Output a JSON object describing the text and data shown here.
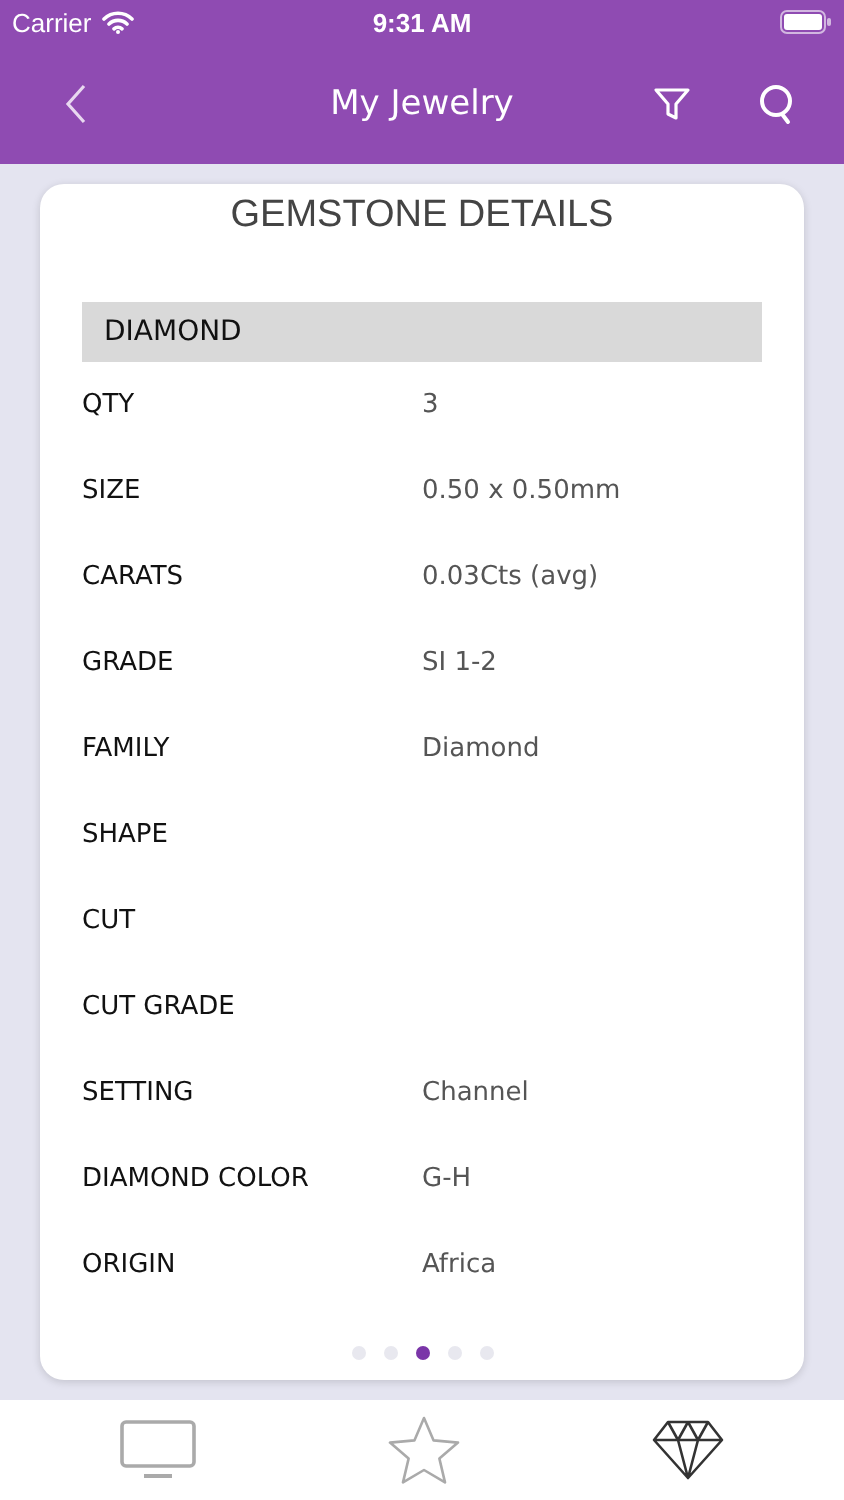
{
  "status_bar": {
    "carrier": "Carrier",
    "time": "9:31 AM"
  },
  "nav": {
    "title": "My Jewelry"
  },
  "card": {
    "title": "GEMSTONE DETAILS",
    "section": "DIAMOND",
    "rows": [
      {
        "label": "QTY",
        "value": "3"
      },
      {
        "label": "SIZE",
        "value": "0.50 x 0.50mm"
      },
      {
        "label": "CARATS",
        "value": "0.03Cts (avg)"
      },
      {
        "label": "GRADE",
        "value": "SI 1-2"
      },
      {
        "label": "FAMILY",
        "value": "Diamond"
      },
      {
        "label": "SHAPE"
      },
      {
        "label": "CUT"
      },
      {
        "label": "CUT GRADE"
      },
      {
        "label": "SETTING",
        "value": "Channel"
      },
      {
        "label": "DIAMOND COLOR",
        "value": "G-H"
      },
      {
        "label": "ORIGIN",
        "value": "Africa"
      }
    ],
    "pages": [
      {
        "selected": false
      },
      {
        "selected": false
      },
      {
        "selected": true
      },
      {
        "selected": false
      },
      {
        "selected": false
      }
    ]
  },
  "tabs": [
    {
      "kind": "screen",
      "selected": false
    },
    {
      "kind": "star",
      "selected": false
    },
    {
      "kind": "diamond",
      "selected": true
    }
  ]
}
